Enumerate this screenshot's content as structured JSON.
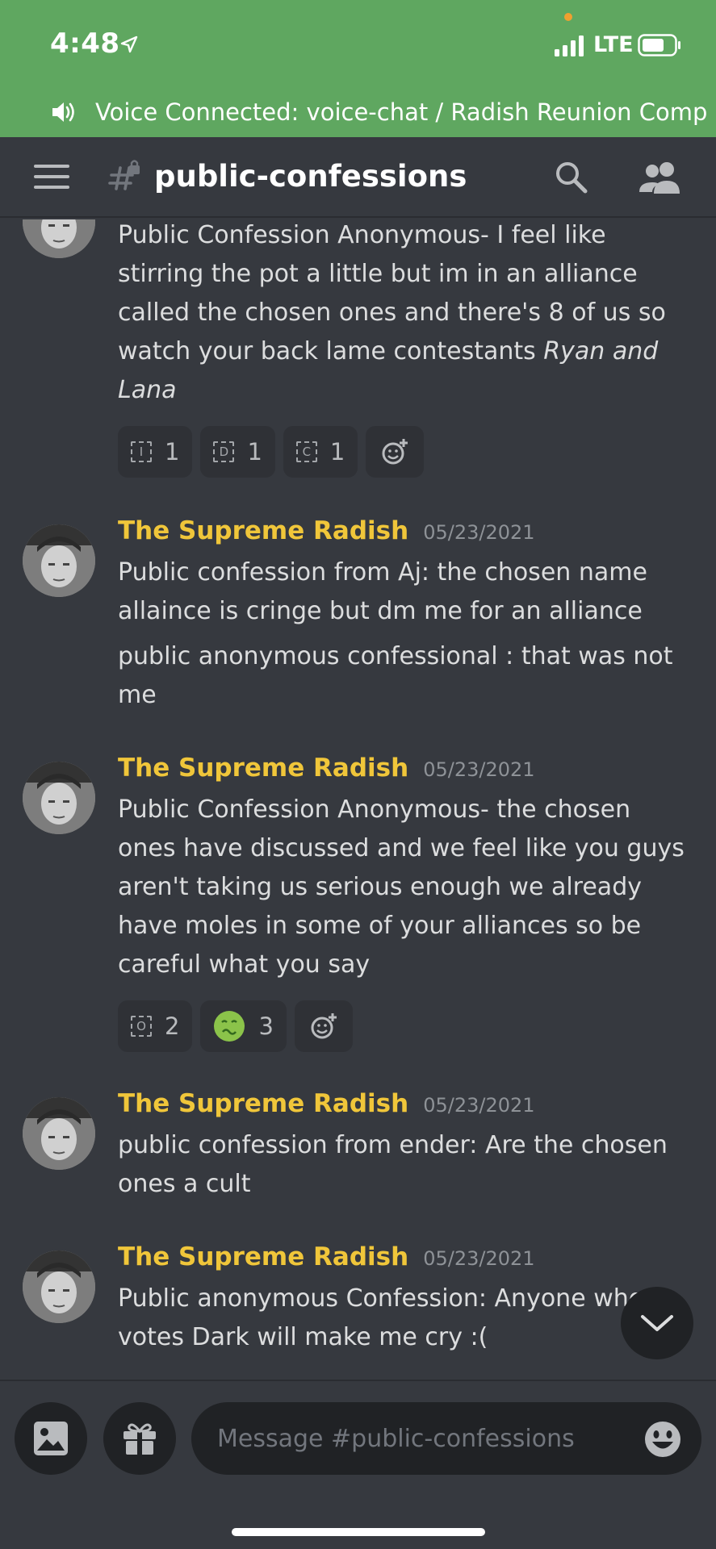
{
  "status_bar": {
    "time": "4:48",
    "network": "LTE"
  },
  "voice_banner": {
    "text": "Voice Connected: voice-chat / Radish Reunion Comp"
  },
  "header": {
    "channel_name": "public-confessions"
  },
  "messages": [
    {
      "author": "",
      "timestamp": "",
      "text_segments": [
        "Public Confession Anonymous- I feel like stirring the pot a little but im in an alliance called the chosen ones and there's 8 of us so watch your back lame contestants ",
        "Ryan and Lana"
      ],
      "reactions": [
        {
          "emoji_label": "I",
          "count": "1"
        },
        {
          "emoji_label": "D",
          "count": "1"
        },
        {
          "emoji_label": "C",
          "count": "1"
        }
      ]
    },
    {
      "author": "The Supreme Radish",
      "timestamp": "05/23/2021",
      "lines": [
        "Public confession from Aj: the chosen name allaince is cringe but dm me for an alliance",
        "public anonymous confessional : that was not me"
      ]
    },
    {
      "author": "The Supreme Radish",
      "timestamp": "05/23/2021",
      "lines": [
        "Public Confession Anonymous- the chosen ones have discussed and we feel like you guys aren't taking us serious enough we already have moles in some of your alliances so be careful what you say"
      ],
      "reactions": [
        {
          "emoji_label": "O",
          "count": "2"
        },
        {
          "emoji_label": "nauseated-face",
          "count": "3"
        }
      ]
    },
    {
      "author": "The Supreme Radish",
      "timestamp": "05/23/2021",
      "lines": [
        "public confession from ender: Are the chosen ones a cult"
      ]
    },
    {
      "author": "The Supreme Radish",
      "timestamp": "05/23/2021",
      "lines": [
        "Public anonymous Confession: Anyone who votes Dark will make me cry :("
      ]
    }
  ],
  "composer": {
    "placeholder": "Message #public-confessions"
  },
  "colors": {
    "status_green": "#5fa760",
    "background": "#36393f",
    "author_gold": "#f0c63a",
    "timestamp_gray": "#8e9297",
    "input_bg": "#202225"
  }
}
